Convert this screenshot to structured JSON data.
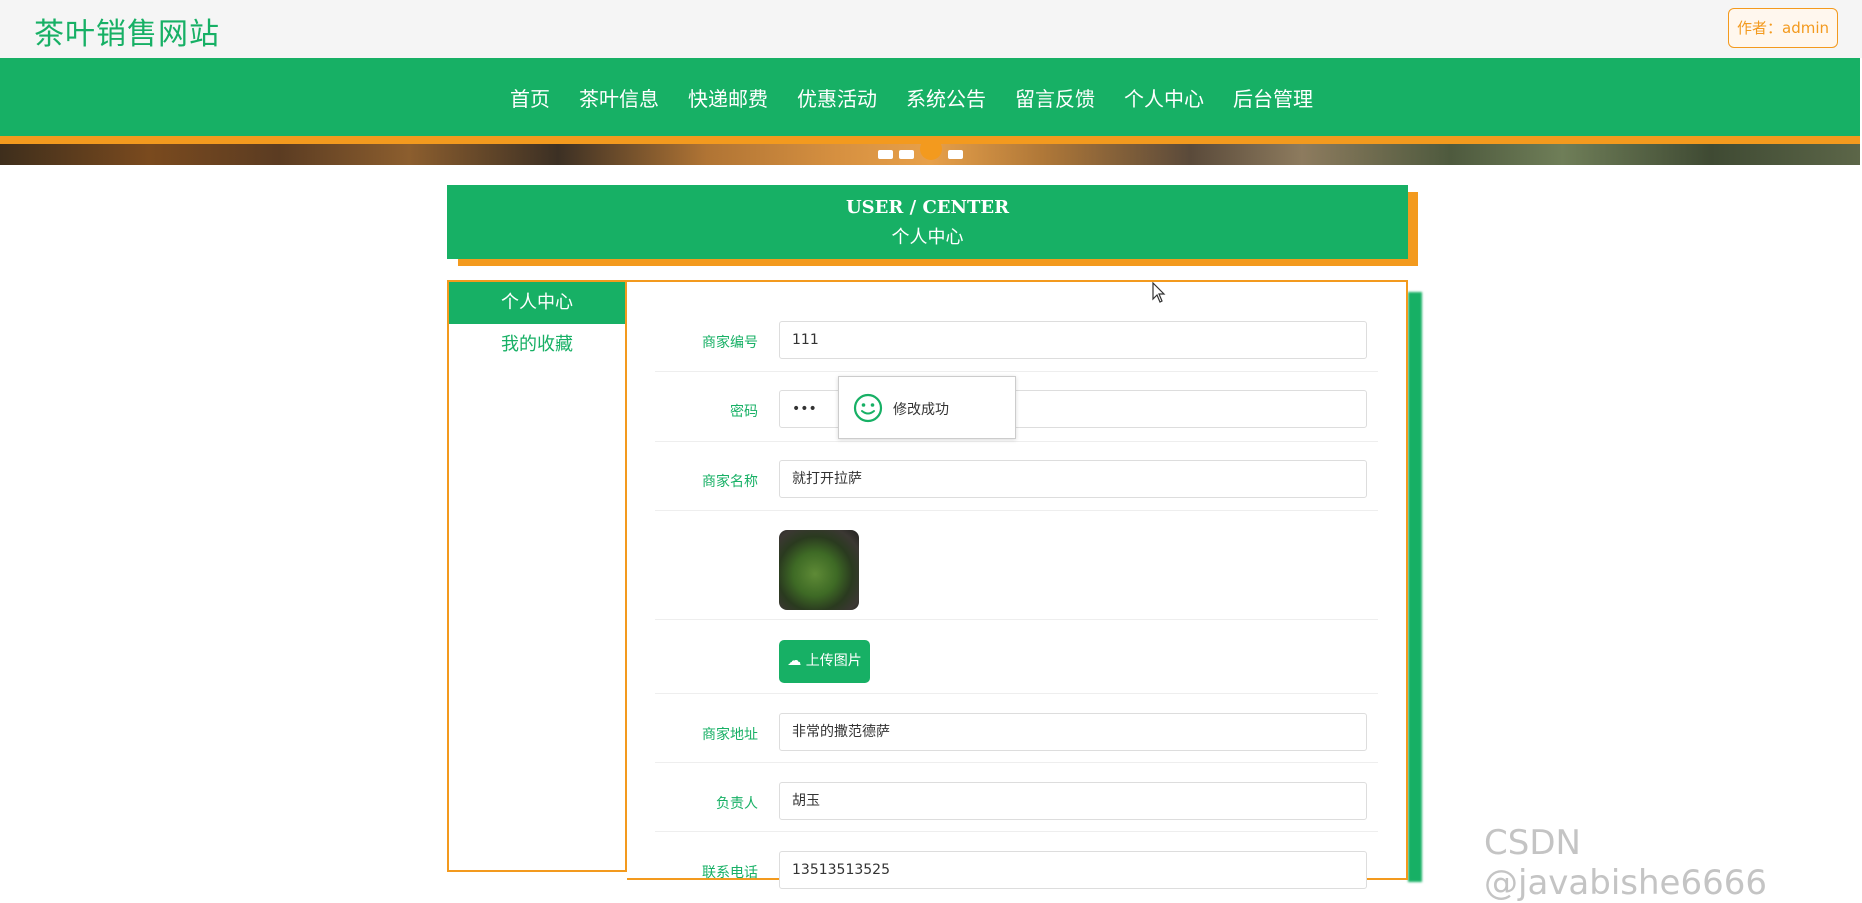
{
  "header": {
    "site_title": "茶叶销售网站",
    "author_label": "作者：admin"
  },
  "nav": {
    "items": [
      "首页",
      "茶叶信息",
      "快递邮费",
      "优惠活动",
      "系统公告",
      "留言反馈",
      "个人中心",
      "后台管理"
    ]
  },
  "banner": {
    "active_dot": 3,
    "dot_count": 4
  },
  "user_center": {
    "title_en": "USER / CENTER",
    "title_cn": "个人中心"
  },
  "sidebar": {
    "items": [
      "个人中心",
      "我的收藏"
    ],
    "active": 0
  },
  "form": {
    "merchant_id": {
      "label": "商家编号",
      "value": "111"
    },
    "password": {
      "label": "密码",
      "value": "•••"
    },
    "merchant_name": {
      "label": "商家名称",
      "value": "就打开拉萨"
    },
    "upload_label": "上传图片",
    "address": {
      "label": "商家地址",
      "value": "非常的撒范德萨"
    },
    "manager": {
      "label": "负责人",
      "value": "胡玉"
    },
    "phone": {
      "label": "联系电话",
      "value": "13513513525"
    }
  },
  "toast": {
    "text": "修改成功"
  },
  "watermark": "CSDN @javabishe6666",
  "colors": {
    "primary": "#17b065",
    "accent": "#f39a1e"
  }
}
